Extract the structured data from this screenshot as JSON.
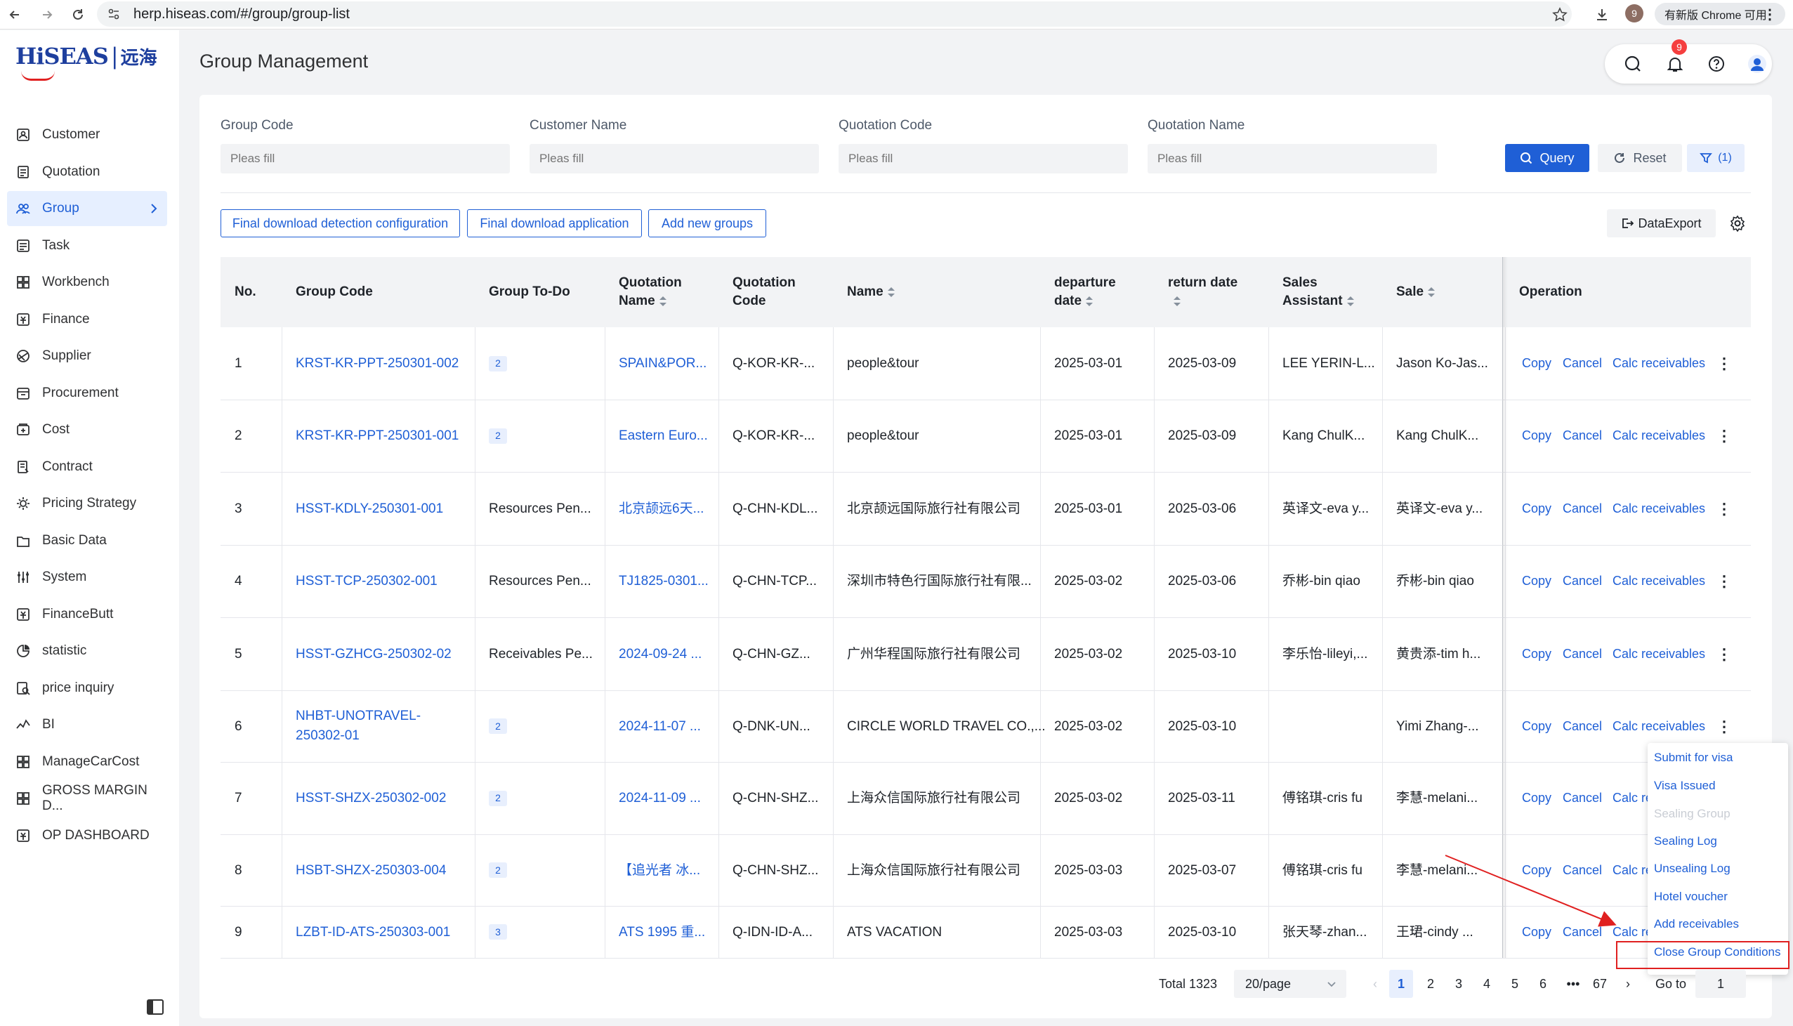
{
  "browser": {
    "url": "herp.hiseas.com/#/group/group-list",
    "profile_initial": "9",
    "update_label": "有新版 Chrome 可用"
  },
  "sidebar": {
    "logo": {
      "brand": "HiSEAS",
      "separator": "|",
      "cn": "远海"
    },
    "items": [
      {
        "label": "Customer",
        "icon": "customer-icon"
      },
      {
        "label": "Quotation",
        "icon": "quotation-icon"
      },
      {
        "label": "Group",
        "icon": "group-icon",
        "active": true
      },
      {
        "label": "Task",
        "icon": "task-icon"
      },
      {
        "label": "Workbench",
        "icon": "workbench-icon"
      },
      {
        "label": "Finance",
        "icon": "finance-icon"
      },
      {
        "label": "Supplier",
        "icon": "supplier-icon"
      },
      {
        "label": "Procurement",
        "icon": "procurement-icon"
      },
      {
        "label": "Cost",
        "icon": "cost-icon"
      },
      {
        "label": "Contract",
        "icon": "contract-icon"
      },
      {
        "label": "Pricing Strategy",
        "icon": "pricing-strategy-icon"
      },
      {
        "label": "Basic Data",
        "icon": "basic-data-icon"
      },
      {
        "label": "System",
        "icon": "system-icon"
      },
      {
        "label": "FinanceButt",
        "icon": "finance-butt-icon"
      },
      {
        "label": "statistic",
        "icon": "statistic-icon"
      },
      {
        "label": "price inquiry",
        "icon": "price-inquiry-icon"
      },
      {
        "label": "BI",
        "icon": "bi-icon"
      },
      {
        "label": "ManageCarCost",
        "icon": "manage-car-cost-icon"
      },
      {
        "label": "GROSS MARGIN D...",
        "icon": "gross-margin-icon"
      },
      {
        "label": "OP DASHBOARD",
        "icon": "op-dashboard-icon"
      }
    ]
  },
  "header": {
    "title": "Group Management",
    "notification_count": "9"
  },
  "filters": {
    "fields": [
      {
        "label": "Group Code",
        "placeholder": "Pleas fill"
      },
      {
        "label": "Customer Name",
        "placeholder": "Pleas fill"
      },
      {
        "label": "Quotation Code",
        "placeholder": "Pleas fill"
      },
      {
        "label": "Quotation Name",
        "placeholder": "Pleas fill"
      }
    ],
    "query_label": "Query",
    "reset_label": "Reset",
    "filter_count": "(1)"
  },
  "toolbar": {
    "final_detection": "Final download detection configuration",
    "final_application": "Final download application",
    "add_groups": "Add new groups",
    "data_export": "DataExport"
  },
  "table": {
    "headers": {
      "no": "No.",
      "group_code": "Group Code",
      "todo": "Group To-Do",
      "quotation_name_1": "Quotation",
      "quotation_name_2": "Name",
      "quotation_code_1": "Quotation",
      "quotation_code_2": "Code",
      "name": "Name",
      "departure_1": "departure",
      "departure_2": "date",
      "return_1": "return date",
      "sales_assistant_1": "Sales",
      "sales_assistant_2": "Assistant",
      "sale": "Sale",
      "operation": "Operation"
    },
    "rows": [
      {
        "no": "1",
        "group_code": "KRST-KR-PPT-250301-002",
        "group_code_2": "",
        "todo": "2",
        "todo_text": "",
        "quotation_name": "SPAIN&POR...",
        "quotation_code": "Q-KOR-KR-...",
        "name": "people&tour",
        "departure": "2025-03-01",
        "return": "2025-03-09",
        "sales_assistant": "LEE YERIN-L...",
        "sale": "Jason Ko-Jas..."
      },
      {
        "no": "2",
        "group_code": "KRST-KR-PPT-250301-001",
        "group_code_2": "",
        "todo": "2",
        "todo_text": "",
        "quotation_name": "Eastern Euro...",
        "quotation_code": "Q-KOR-KR-...",
        "name": "people&tour",
        "departure": "2025-03-01",
        "return": "2025-03-09",
        "sales_assistant": "Kang ChulK...",
        "sale": "Kang ChulK..."
      },
      {
        "no": "3",
        "group_code": "HSST-KDLY-250301-001",
        "group_code_2": "",
        "todo": "",
        "todo_text": "Resources Pen...",
        "quotation_name": "北京颉远6天...",
        "quotation_code": "Q-CHN-KDL...",
        "name": "北京颉远国际旅行社有限公司",
        "departure": "2025-03-01",
        "return": "2025-03-06",
        "sales_assistant": "英译文-eva y...",
        "sale": "英译文-eva y..."
      },
      {
        "no": "4",
        "group_code": "HSST-TCP-250302-001",
        "group_code_2": "",
        "todo": "",
        "todo_text": "Resources Pen...",
        "quotation_name": "TJ1825-0301...",
        "quotation_code": "Q-CHN-TCP...",
        "name": "深圳市特色行国际旅行社有限...",
        "departure": "2025-03-02",
        "return": "2025-03-06",
        "sales_assistant": "乔彬-bin qiao",
        "sale": "乔彬-bin qiao"
      },
      {
        "no": "5",
        "group_code": "HSST-GZHCG-250302-02",
        "group_code_2": "",
        "todo": "",
        "todo_text": "Receivables Pe...",
        "quotation_name": "2024-09-24 ...",
        "quotation_code": "Q-CHN-GZ...",
        "name": "广州华程国际旅行社有限公司",
        "departure": "2025-03-02",
        "return": "2025-03-10",
        "sales_assistant": "李乐怡-lileyi,...",
        "sale": "黄贵添-tim h..."
      },
      {
        "no": "6",
        "group_code": "NHBT-UNOTRAVEL-",
        "group_code_2": "250302-01",
        "todo": "2",
        "todo_text": "",
        "quotation_name": "2024-11-07 ...",
        "quotation_code": "Q-DNK-UN...",
        "name": "CIRCLE WORLD TRAVEL CO.,...",
        "departure": "2025-03-02",
        "return": "2025-03-10",
        "sales_assistant": "",
        "sale": "Yimi Zhang-..."
      },
      {
        "no": "7",
        "group_code": "HSST-SHZX-250302-002",
        "group_code_2": "",
        "todo": "2",
        "todo_text": "",
        "quotation_name": "2024-11-09 ...",
        "quotation_code": "Q-CHN-SHZ...",
        "name": "上海众信国际旅行社有限公司",
        "departure": "2025-03-02",
        "return": "2025-03-11",
        "sales_assistant": "傅铭琪-cris fu",
        "sale": "李慧-melani..."
      },
      {
        "no": "8",
        "group_code": "HSBT-SHZX-250303-004",
        "group_code_2": "",
        "todo": "2",
        "todo_text": "",
        "quotation_name": "【追光者 冰...",
        "quotation_code": "Q-CHN-SHZ...",
        "name": "上海众信国际旅行社有限公司",
        "departure": "2025-03-03",
        "return": "2025-03-07",
        "sales_assistant": "傅铭琪-cris fu",
        "sale": "李慧-melani..."
      },
      {
        "no": "9",
        "group_code": "LZBT-ID-ATS-250303-001",
        "group_code_2": "",
        "todo": "3",
        "todo_text": "",
        "quotation_name": "ATS 1995 重...",
        "quotation_code": "Q-IDN-ID-A...",
        "name": "ATS VACATION",
        "departure": "2025-03-03",
        "return": "2025-03-10",
        "sales_assistant": "张天琴-zhan...",
        "sale": "王珺-cindy ..."
      }
    ],
    "ops": {
      "copy": "Copy",
      "cancel": "Cancel",
      "calc": "Calc receivables",
      "calc_short": "Calc re"
    }
  },
  "dropdown": {
    "items": [
      {
        "label": "Submit for visa",
        "disabled": false
      },
      {
        "label": "Visa Issued",
        "disabled": false
      },
      {
        "label": "Sealing Group",
        "disabled": true
      },
      {
        "label": "Sealing Log",
        "disabled": false
      },
      {
        "label": "Unsealing Log",
        "disabled": false
      },
      {
        "label": "Hotel voucher",
        "disabled": false
      },
      {
        "label": "Add receivables",
        "disabled": false
      },
      {
        "label": "Close Group Conditions",
        "disabled": false
      }
    ]
  },
  "pagination": {
    "total": "Total 1323",
    "page_size": "20/page",
    "pages": [
      "1",
      "2",
      "3",
      "4",
      "5",
      "6",
      "•••",
      "67"
    ],
    "current": "1",
    "goto_label": "Go to",
    "goto_value": "1"
  },
  "colors": {
    "primary": "#1f5fd6",
    "highlight": "#e02020",
    "badge": "#f53f3f"
  }
}
